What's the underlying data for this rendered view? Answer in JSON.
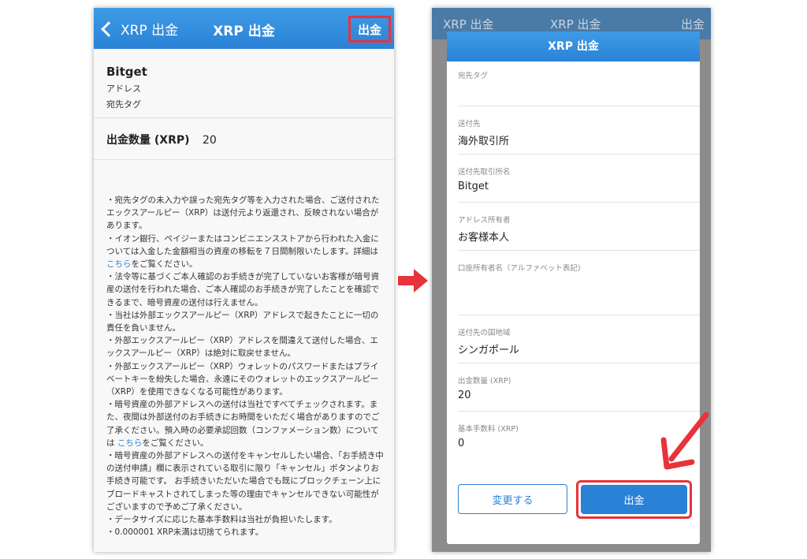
{
  "left": {
    "back_label": "XRP 出金",
    "title": "XRP 出金",
    "action_label": "出金",
    "exchange": "Bitget",
    "address_label": "アドレス",
    "tag_label": "宛先タグ",
    "amount_label": "出金数量 (XRP)",
    "amount_value": "20",
    "notes": {
      "p1": "・宛先タグの未入力や誤った宛先タグ等を入力された場合、ご送付されたエックスアールピー（XRP）は送付元より返還され、反映されない場合があります。",
      "p2a": "・イオン銀行、ペイジーまたはコンビニエンスストアから行われた入金については入金した金額相当の資産の移転を７日間制限いたします。詳細は ",
      "p2link": "こちら",
      "p2b": "をご覧ください。",
      "p3": "・法令等に基づくご本人確認のお手続きが完了していないお客様が暗号資産の送付を行われた場合、ご本人確認のお手続きが完了したことを確認できるまで、暗号資産の送付は行えません。",
      "p4": "・当社は外部エックスアールピー（XRP）アドレスで起きたことに一切の責任を負いません。",
      "p5": "・外部エックスアールピー（XRP）アドレスを間違えて送付した場合、エックスアールピー（XRP）は絶対に取戻せません。",
      "p6": "・外部エックスアールピー（XRP）ウォレットのパスワードまたはプライベートキーを紛失した場合、永遠にそのウォレットのエックスアールピー（XRP）を使用できなくなる可能性があります。",
      "p7a": "・暗号資産の外部アドレスへの送付は当社ですべてチェックされます。また、夜間は外部送付のお手続きにお時間をいただく場合がありますのでご了承ください。預入時の必要承認回数（コンファメーション数）については ",
      "p7link": "こちら",
      "p7b": "をご覧ください。",
      "p8": "・暗号資産の外部アドレスへの送付をキャンセルしたい場合、「お手続き中の送付申請」欄に表示されている取引に限り「キャンセル」ボタンよりお手続き可能です。 お手続きいただいた場合でも既にブロックチェーン上にブロードキャストされてしまった等の理由でキャンセルできない可能性がございますので予めご了承ください。",
      "p9": "・データサイズに応じた基本手数料は当社が負担いたします。",
      "p10": "・0.000001 XRP未満は切捨てられます。"
    }
  },
  "right": {
    "bg_back": "XRP 出金",
    "bg_title": "XRP 出金",
    "bg_action": "出金",
    "modal_title": "XRP 出金",
    "fields": [
      {
        "label": "宛先タグ",
        "value": ""
      },
      {
        "label": "送付先",
        "value": "海外取引所"
      },
      {
        "label": "送付先取引所名",
        "value": "Bitget"
      },
      {
        "label": "アドレス所有者",
        "value": "お客様本人"
      },
      {
        "label": "口座所有者名（アルファベット表記)",
        "value": ""
      },
      {
        "label": "送付先の国地域",
        "value": "シンガポール"
      },
      {
        "label": "出金数量 (XRP)",
        "value": "20"
      },
      {
        "label": "基本手数料 (XRP)",
        "value": "0"
      }
    ],
    "change_button": "変更する",
    "submit_button": "出金"
  },
  "colors": {
    "header_blue": "#2a82d6",
    "highlight_red": "#e8333a"
  }
}
